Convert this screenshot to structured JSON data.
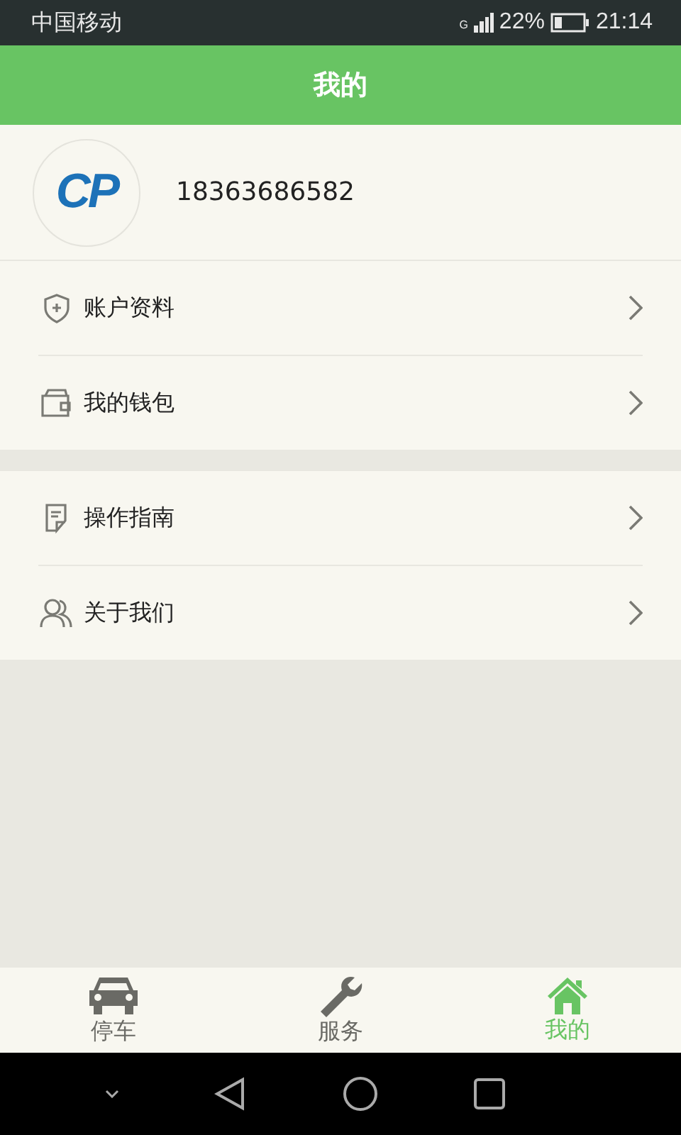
{
  "status_bar": {
    "carrier": "中国移动",
    "network": "G",
    "battery": "22%",
    "time": "21:14"
  },
  "header": {
    "title": "我的"
  },
  "profile": {
    "logo": "CP",
    "phone": "18363686582"
  },
  "menu_groups": [
    {
      "items": [
        {
          "label": "账户资料",
          "kind": "shield"
        },
        {
          "label": "我的钱包",
          "kind": "wallet"
        }
      ]
    },
    {
      "items": [
        {
          "label": "操作指南",
          "kind": "guide"
        },
        {
          "label": "关于我们",
          "kind": "people"
        }
      ]
    }
  ],
  "tabs": [
    {
      "label": "停车",
      "kind": "car",
      "selected": false
    },
    {
      "label": "服务",
      "kind": "wrench",
      "selected": false
    },
    {
      "label": "我的",
      "kind": "home",
      "selected": true
    }
  ]
}
